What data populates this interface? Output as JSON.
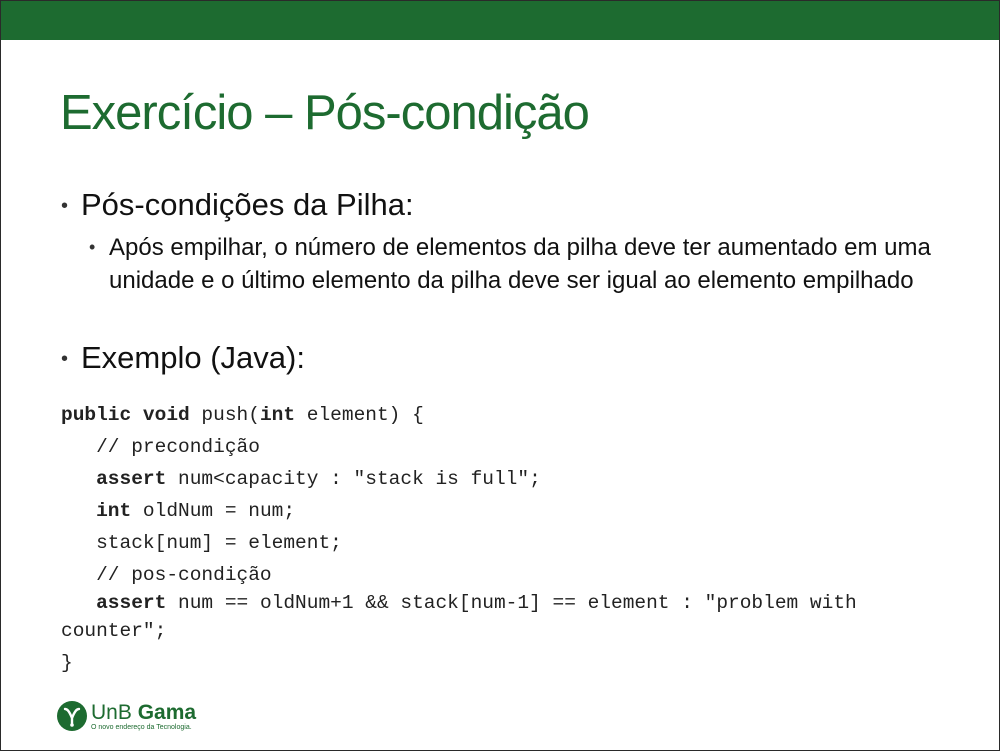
{
  "slide": {
    "title": "Exercício – Pós-condição",
    "bullets": [
      {
        "text": "Pós-condições da Pilha:",
        "sub": "Após empilhar, o número de elementos da pilha deve ter aumentado em uma unidade e o último elemento da pilha deve ser igual ao elemento empilhado"
      },
      {
        "text": "Exemplo (Java):"
      }
    ],
    "bullet_glyph": "•",
    "code": {
      "l1_kw": "public void",
      "l1_rest": " push(",
      "l1_kw2": "int",
      "l1_end": " element) {",
      "l2": "   // precondição",
      "l3_kw": "assert",
      "l3_rest": " num<capacity : \"stack is full\";",
      "l4_kw": "int",
      "l4_rest": " oldNum = num;",
      "l5": "   stack[num] = element;",
      "l6": "   // pos-condição",
      "l7_kw": "assert",
      "l7_rest": " num == oldNum+1 && stack[num-1] == element : \"problem with",
      "l8": "counter\";",
      "l9": "}"
    }
  },
  "logo": {
    "name_light": "UnB ",
    "name_bold": "Gama",
    "tagline": "O novo endereço da Tecnologia."
  },
  "colors": {
    "brand_green": "#1d6b30"
  }
}
